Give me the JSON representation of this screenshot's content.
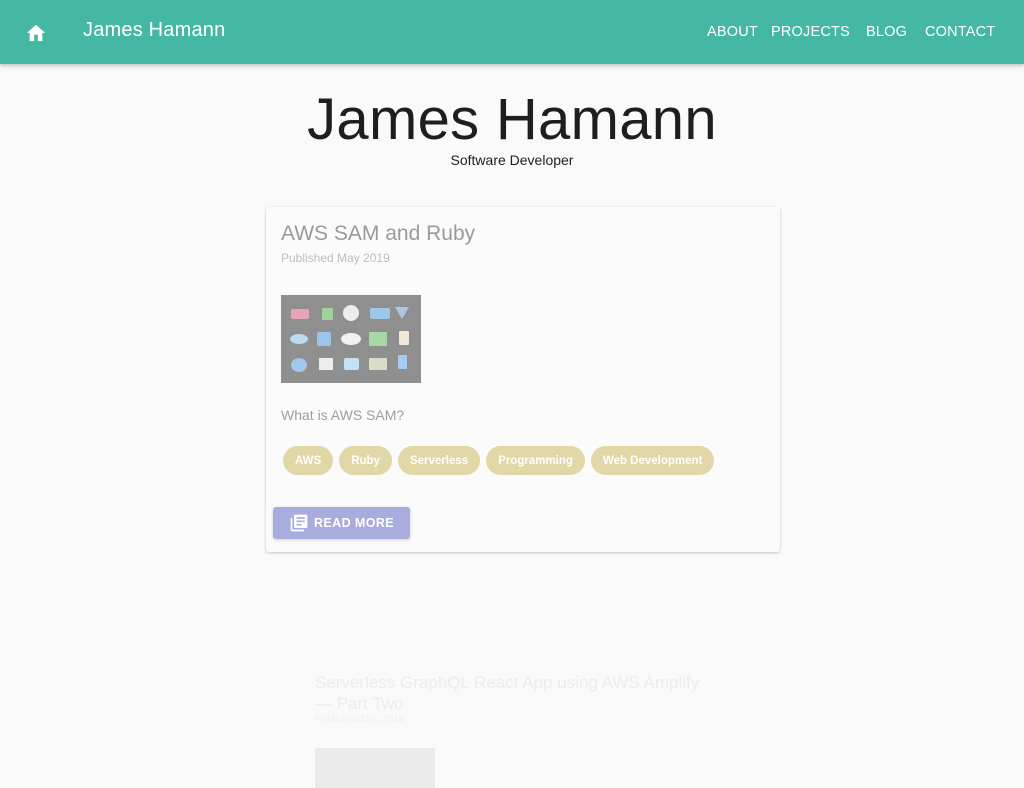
{
  "appbar": {
    "brand": "James Hamann",
    "home_icon": "home-icon",
    "nav": [
      "ABOUT",
      "PROJECTS",
      "BLOG",
      "CONTACT"
    ]
  },
  "hero": {
    "title": "James Hamann",
    "subtitle": "Software Developer"
  },
  "posts": [
    {
      "title": "AWS SAM and Ruby",
      "date": "Published May 2019",
      "excerpt": "What is AWS SAM?",
      "tags": [
        "AWS",
        "Ruby",
        "Serverless",
        "Programming",
        "Web Development"
      ],
      "read_more": "READ MORE",
      "read_more_icon": "article-icon"
    },
    {
      "title": "Serverless GraphQL React App using AWS Amplify — Part Two",
      "date": "Published Dec 2018"
    }
  ],
  "colors": {
    "appbar": "#44b8a4",
    "tag": "#e2d7a6",
    "button": "#a8acdf",
    "background": "#fafafa"
  }
}
